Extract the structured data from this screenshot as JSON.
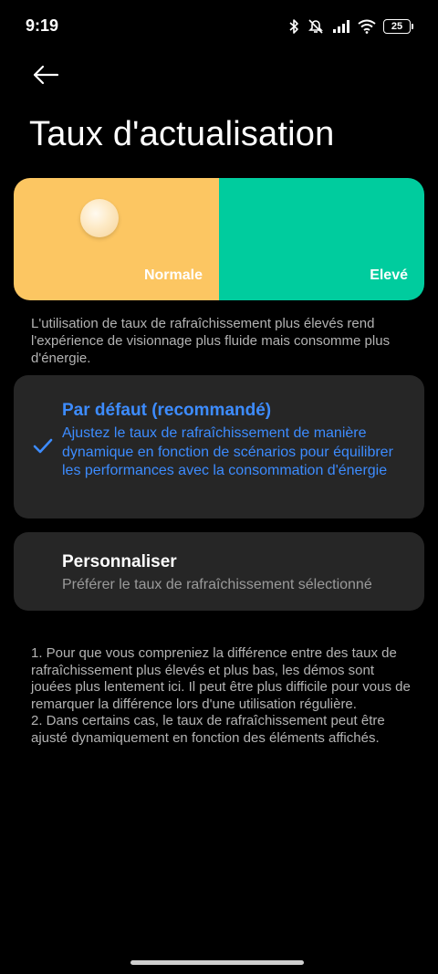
{
  "status_bar": {
    "time": "9:19",
    "battery_level": "25",
    "icons": [
      "bluetooth-icon",
      "vibrate-off-icon",
      "signal-icon",
      "wifi-icon",
      "battery-icon"
    ]
  },
  "header": {
    "back_icon": "arrow-left-icon",
    "title": "Taux d'actualisation"
  },
  "preview": {
    "normal_label": "Normale",
    "high_label": "Elevé",
    "normal_color": "#fcc662",
    "high_color": "#00cc9e"
  },
  "description": "L'utilisation de taux de rafraîchissement plus élevés rend l'expérience de visionnage plus fluide mais consomme plus d'énergie.",
  "options": [
    {
      "title": "Par défaut (recommandé)",
      "description": "Ajustez le taux de rafraîchissement de manière dynamique en fonction de scénarios pour équilibrer les performances avec la consommation d'énergie",
      "selected": true
    },
    {
      "title": "Personnaliser",
      "description": "Préférer le taux de rafraîchissement sélectionné",
      "selected": false
    }
  ],
  "accent_color": "#3d8cff",
  "notes": [
    "1. Pour que vous compreniez la différence entre des taux de rafraîchissement plus élevés et plus bas, les démos sont jouées plus lentement ici. Il peut être plus difficile pour vous de remarquer la différence lors d'une utilisation régulière.",
    "2. Dans certains cas, le taux de rafraîchissement peut être ajusté dynamiquement en fonction des éléments affichés."
  ]
}
